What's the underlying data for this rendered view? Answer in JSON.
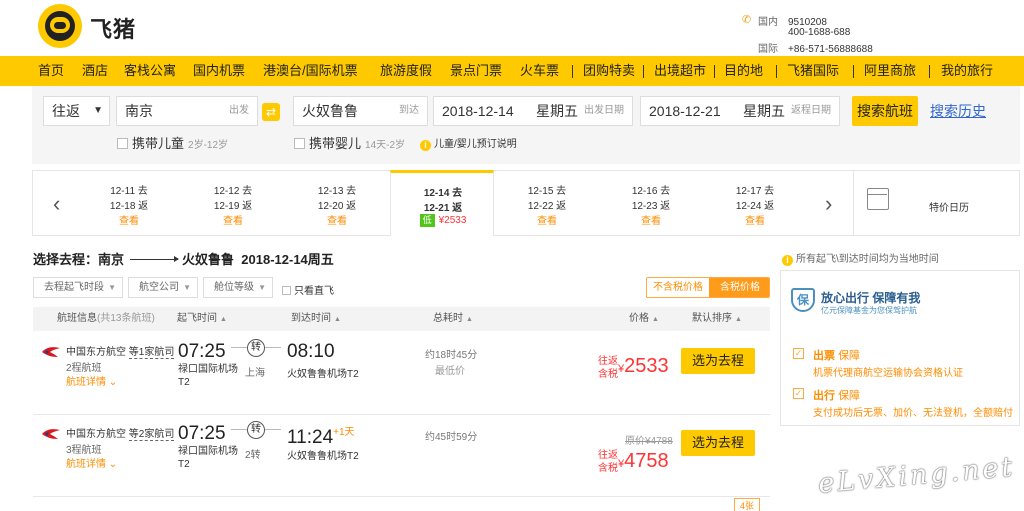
{
  "header": {
    "brand": "飞猪",
    "phones": [
      {
        "label": "国内",
        "number": "9510208"
      },
      {
        "label": "",
        "number": "400-1688-688"
      },
      {
        "label": "国际",
        "number": "+86-571-56888688"
      }
    ]
  },
  "nav": [
    "首页",
    "酒店",
    "客栈公寓",
    "国内机票",
    "港澳台/国际机票",
    "旅游度假",
    "景点门票",
    "火车票",
    "团购特卖",
    "出境超市",
    "目的地",
    "飞猪国际",
    "阿里商旅",
    "我的旅行"
  ],
  "search": {
    "trip_type": "往返",
    "from_city": "南京",
    "from_hint": "出发",
    "to_city": "火奴鲁鲁",
    "to_hint": "到达",
    "depart_date": "2018-12-14",
    "depart_week": "星期五",
    "depart_hint": "出发日期",
    "return_date": "2018-12-21",
    "return_week": "星期五",
    "return_hint": "返程日期",
    "search_button": "搜索航班",
    "history_link": "搜索历史",
    "child_label": "携带儿童",
    "child_age": "2岁-12岁",
    "infant_label": "携带婴儿",
    "infant_age": "14天-2岁",
    "info_note": "儿童/婴儿预订说明"
  },
  "date_strip": {
    "cells": [
      {
        "l1": "12-11 去",
        "l2": "12-18 返",
        "l3": "查看"
      },
      {
        "l1": "12-12 去",
        "l2": "12-19 返",
        "l3": "查看"
      },
      {
        "l1": "12-13 去",
        "l2": "12-20 返",
        "l3": "查看"
      },
      {
        "l1": "12-14 去",
        "l2": "12-21 返",
        "badge": "低",
        "price": "¥2533"
      },
      {
        "l1": "12-15 去",
        "l2": "12-22 返",
        "l3": "查看"
      },
      {
        "l1": "12-16 去",
        "l2": "12-23 返",
        "l3": "查看"
      },
      {
        "l1": "12-17 去",
        "l2": "12-24 返",
        "l3": "查看"
      }
    ],
    "calendar_label": "特价日历"
  },
  "route": {
    "prefix": "选择去程：",
    "from": "南京",
    "to": "火奴鲁鲁",
    "date": "2018-12-14周五"
  },
  "filters": {
    "dep_period": "去程起飞时段",
    "airline": "航空公司",
    "cabin": "舱位等级",
    "direct": "只看直飞",
    "tax_excl": "不含税价格",
    "tax_incl": "含税价格"
  },
  "table_head": {
    "info": "航班信息",
    "info_count": "(共13条航班)",
    "dep": "起飞时间",
    "arr": "到达时间",
    "total": "总耗时",
    "price": "价格",
    "sort": "默认排序"
  },
  "flights": [
    {
      "airline": "中国东方航空",
      "share": "等1家航司",
      "stops": "2程航班",
      "details": "航班详情",
      "dep_time": "07:25",
      "dep_airport": "禄口国际机场T2",
      "stop_label": "转",
      "stop_city": "上海",
      "arr_time": "08:10",
      "arr_plus": "",
      "arr_airport": "火奴鲁鲁机场T2",
      "duration": "约18时45分",
      "lowest": "最低价",
      "orig_price": "",
      "tag1": "往返",
      "tag2": "含税",
      "yen": "¥",
      "price": "2533",
      "select": "选为去程"
    },
    {
      "airline": "中国东方航空",
      "share": "等2家航司",
      "stops": "3程航班",
      "details": "航班详情",
      "dep_time": "07:25",
      "dep_airport": "禄口国际机场T2",
      "stop_label": "转",
      "stop_city": "2转",
      "arr_time": "11:24",
      "arr_plus": "+1天",
      "arr_airport": "火奴鲁鲁机场T2",
      "duration": "约45时59分",
      "lowest": "",
      "orig_price": "原价¥4788",
      "tag1": "往返",
      "tag2": "含税",
      "yen": "¥",
      "price": "4758",
      "select": "选为去程"
    }
  ],
  "stock_badge": "4张",
  "sidebar": {
    "note": "所有起飞\\到达时间均为当地时间",
    "shield": "保",
    "title": "放心出行 保障有我",
    "subtitle": "亿元保障基金为您保驾护航",
    "items": [
      {
        "head": "出票",
        "tag": "保障",
        "desc": "机票代理商航空运输协会资格认证"
      },
      {
        "head": "出行",
        "tag": "保障",
        "desc": "支付成功后无票、加价、无法登机，全额赔付"
      }
    ]
  },
  "watermark": "eLvXing.net",
  "colors": {
    "accent": "#ffc900",
    "price": "#ff3333",
    "link": "#3366cc",
    "orange": "#ff8c00"
  }
}
